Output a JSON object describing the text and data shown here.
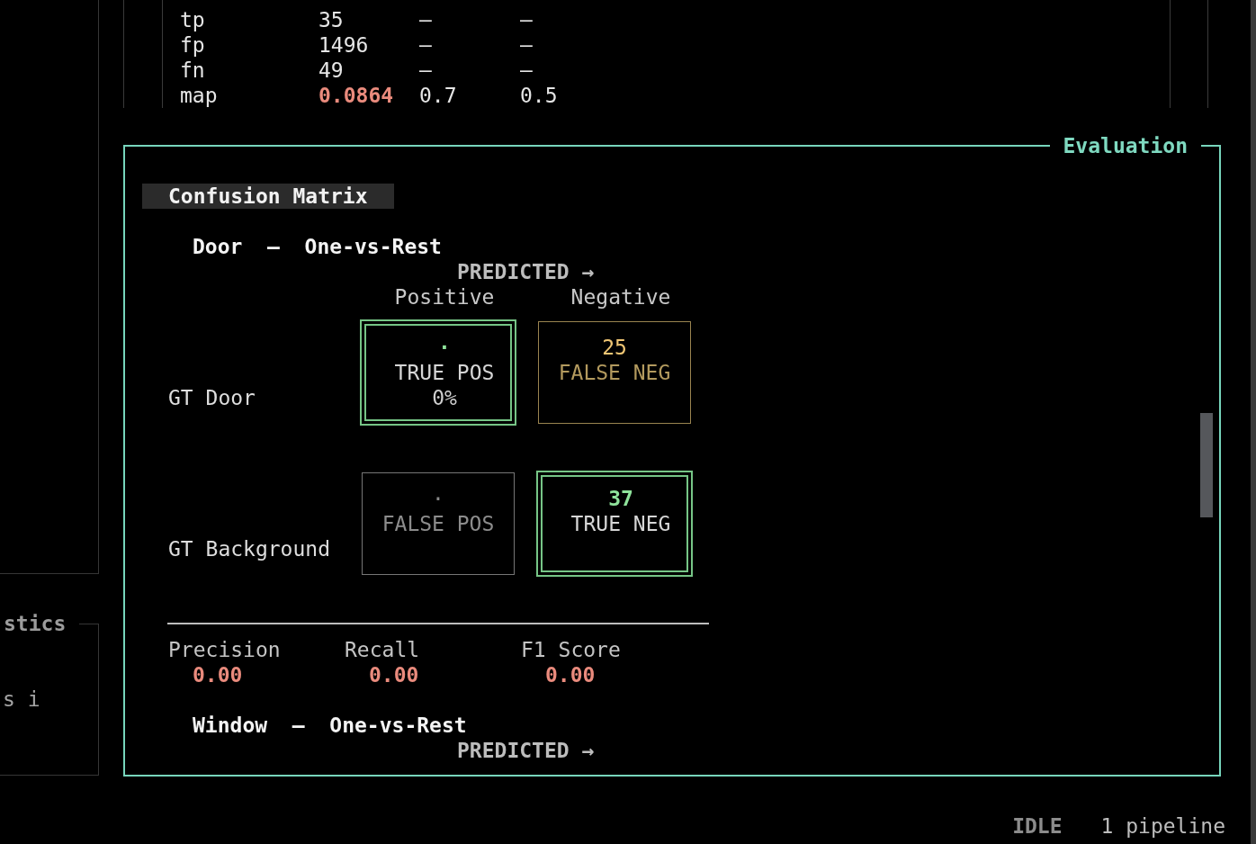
{
  "results_table": {
    "rows": [
      {
        "cells": [
          "tp",
          "35",
          "—",
          "—"
        ],
        "highlighted": false
      },
      {
        "cells": [
          "fp",
          "1496",
          "—",
          "—"
        ],
        "highlighted": false
      },
      {
        "cells": [
          "fn",
          "49",
          "—",
          "—"
        ],
        "highlighted": false
      },
      {
        "cells": [
          "map",
          "0.0864",
          "0.7",
          "0.5"
        ],
        "highlighted": true
      }
    ]
  },
  "diagnostics_panel": {
    "title": "stics",
    "lines": [
      "s i"
    ]
  },
  "evaluation": {
    "title": "Evaluation",
    "section_title": "Confusion Matrix",
    "matrices": [
      {
        "heading": "Door  —  One-vs-Rest",
        "axis_label": "PREDICTED →",
        "columns": [
          "Positive",
          "Negative"
        ],
        "rows": [
          {
            "label": "GT Door",
            "cells": [
              {
                "kind": "tp",
                "value": "·",
                "label": "TRUE POS",
                "percent": "0%"
              },
              {
                "kind": "fn",
                "value": "25",
                "label": "FALSE NEG"
              }
            ]
          },
          {
            "label": "GT Background",
            "cells": [
              {
                "kind": "fp",
                "value": "·",
                "label": "FALSE POS"
              },
              {
                "kind": "tn",
                "value": "37",
                "label": "TRUE NEG"
              }
            ]
          }
        ],
        "metrics": [
          {
            "label": "Precision",
            "value": "0.00"
          },
          {
            "label": "Recall",
            "value": "0.00"
          },
          {
            "label": "F1 Score",
            "value": "0.00"
          }
        ]
      },
      {
        "heading": "Window  —  One-vs-Rest",
        "axis_label": "PREDICTED →"
      }
    ]
  },
  "status_bar": {
    "state": "IDLE",
    "pipelines": "1 pipeline"
  }
}
